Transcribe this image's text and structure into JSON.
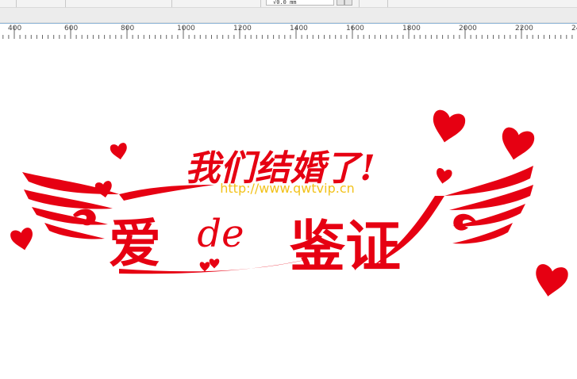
{
  "toolbar": {
    "zoom_value": "√0.0 mm"
  },
  "ruler": {
    "ticks": [
      {
        "label": "400",
        "v": 400
      },
      {
        "label": "600",
        "v": 600
      },
      {
        "label": "800",
        "v": 800
      },
      {
        "label": "1000",
        "v": 1000
      },
      {
        "label": "1200",
        "v": 1200
      },
      {
        "label": "1400",
        "v": 1400
      },
      {
        "label": "1600",
        "v": 1600
      },
      {
        "label": "1800",
        "v": 1800
      },
      {
        "label": "2000",
        "v": 2000
      },
      {
        "label": "2200",
        "v": 2200
      },
      {
        "label": "24",
        "v": 2400
      }
    ]
  },
  "artwork": {
    "line1": "我们结婚了!",
    "line2_left": "爱",
    "line2_mid": "de",
    "line2_right": "鉴证",
    "watermark": "http://www.qwtvip.cn",
    "primary_color": "#e60012",
    "watermark_color": "#f2c21b"
  }
}
